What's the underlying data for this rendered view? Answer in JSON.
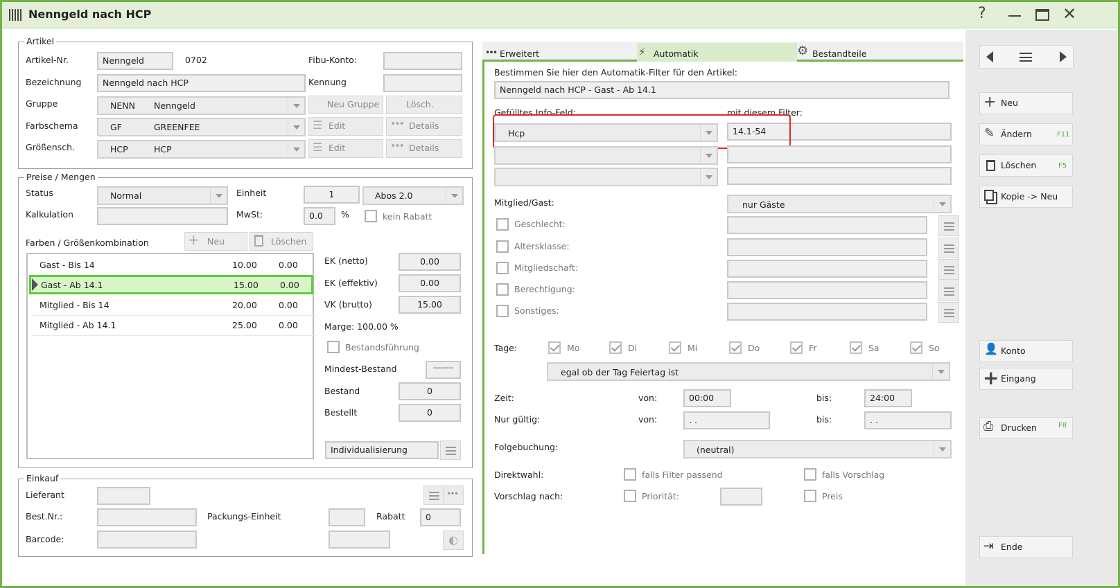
{
  "window": {
    "title": "Nenngeld nach HCP"
  },
  "artikel": {
    "title": "Artikel",
    "nr_label": "Artikel-Nr.",
    "nr_value": "Nenngeld",
    "nr_code": "0702",
    "fibu_label": "Fibu-Konto:",
    "bez_label": "Bezeichnung",
    "bez_value": "Nenngeld nach HCP",
    "kennung_label": "Kennung",
    "gruppe_label": "Gruppe",
    "gruppe_code": "NENN",
    "gruppe_name": "Nenngeld",
    "neu_gruppe": "Neu Gruppe",
    "losch": "Lösch.",
    "farb_label": "Farbschema",
    "farb_code": "GF",
    "farb_name": "GREENFEE",
    "edit1": "Edit",
    "details1": "Details",
    "gross_label": "Größensch.",
    "gross_code": "HCP",
    "gross_name": "HCP",
    "edit2": "Edit",
    "details2": "Details"
  },
  "preise": {
    "title": "Preise / Mengen",
    "status_label": "Status",
    "status_value": "Normal",
    "einheit_label": "Einheit",
    "einheit_value": "1",
    "abos_value": "Abos 2.0",
    "kalk_label": "Kalkulation",
    "mwst_label": "MwSt:",
    "mwst_value": "0.0",
    "pct": "%",
    "kein_rabatt": "kein Rabatt",
    "fg_label": "Farben / Größenkombination",
    "neu": "Neu",
    "loeschen": "Löschen",
    "rows": [
      {
        "name": "Gast - Bis 14",
        "a": "10.00",
        "b": "0.00"
      },
      {
        "name": "Gast - Ab 14.1",
        "a": "15.00",
        "b": "0.00"
      },
      {
        "name": "Mitglied - Bis 14",
        "a": "20.00",
        "b": "0.00"
      },
      {
        "name": "Mitglied - Ab 14.1",
        "a": "25.00",
        "b": "0.00"
      }
    ],
    "ek_netto_label": "EK (netto)",
    "ek_netto": "0.00",
    "ek_eff_label": "EK (effektiv)",
    "ek_eff": "0.00",
    "vk_label": "VK (brutto)",
    "vk": "15.00",
    "marge": "Marge: 100.00 %",
    "bestand_fuehrung": "Bestandsführung",
    "mindest_label": "Mindest-Bestand",
    "mindest_value": "--------",
    "bestand_label": "Bestand",
    "bestand_value": "0",
    "bestellt_label": "Bestellt",
    "bestellt_value": "0",
    "indiv": "Individualisierung"
  },
  "einkauf": {
    "title": "Einkauf",
    "lieferant": "Lieferant",
    "bestnr": "Best.Nr.:",
    "packung": "Packungs-Einheit",
    "rabatt": "Rabatt",
    "rabatt_value": "0",
    "barcode": "Barcode:"
  },
  "tabs": [
    {
      "label": "Erweitert"
    },
    {
      "label": "Automatik"
    },
    {
      "label": "Bestandteile"
    }
  ],
  "auto": {
    "intro": "Bestimmen Sie hier den Automatik-Filter für den Artikel:",
    "filter_name": "Nenngeld nach HCP - Gast - Ab 14.1",
    "info_label": "Gefülltes Info-Feld:",
    "filter_label": "mit diesem Filter:",
    "info_value": "Hcp",
    "filter_value": "14.1-54",
    "mg_label": "Mitglied/Gast:",
    "mg_value": "nur Gäste",
    "geschlecht": "Geschlecht:",
    "altersklasse": "Altersklasse:",
    "mitgliedschaft": "Mitgliedschaft:",
    "berechtigung": "Berechtigung:",
    "sonstiges": "Sonstiges:",
    "tage_label": "Tage:",
    "days": [
      "Mo",
      "Di",
      "Mi",
      "Do",
      "Fr",
      "Sa",
      "So"
    ],
    "feiertag": "egal ob der Tag Feiertag ist",
    "zeit_label": "Zeit:",
    "von": "von:",
    "bis": "bis:",
    "zeit_von": "00:00",
    "zeit_bis": "24:00",
    "gueltig_label": "Nur gültig:",
    "gueltig_von": ". .",
    "gueltig_bis": ". .",
    "folge_label": "Folgebuchung:",
    "folge_value": "(neutral)",
    "direkt_label": "Direktwahl:",
    "falls_filter": "falls Filter passend",
    "falls_vorschlag": "falls Vorschlag",
    "vorschlag_label": "Vorschlag nach:",
    "prioritaet": "Priorität:",
    "preis": "Preis"
  },
  "side": {
    "neu": "Neu",
    "aendern": "Ändern",
    "aendern_key": "F11",
    "loeschen": "Löschen",
    "loeschen_key": "F5",
    "kopie": "Kopie -> Neu",
    "konto": "Konto",
    "eingang": "Eingang",
    "drucken": "Drucken",
    "drucken_key": "F8",
    "ende": "Ende"
  },
  "colors": {
    "accent": "#74b24a",
    "titlebar": "#e3f0d7",
    "highlight": "#d8f5c8",
    "red": "#e0262b"
  }
}
